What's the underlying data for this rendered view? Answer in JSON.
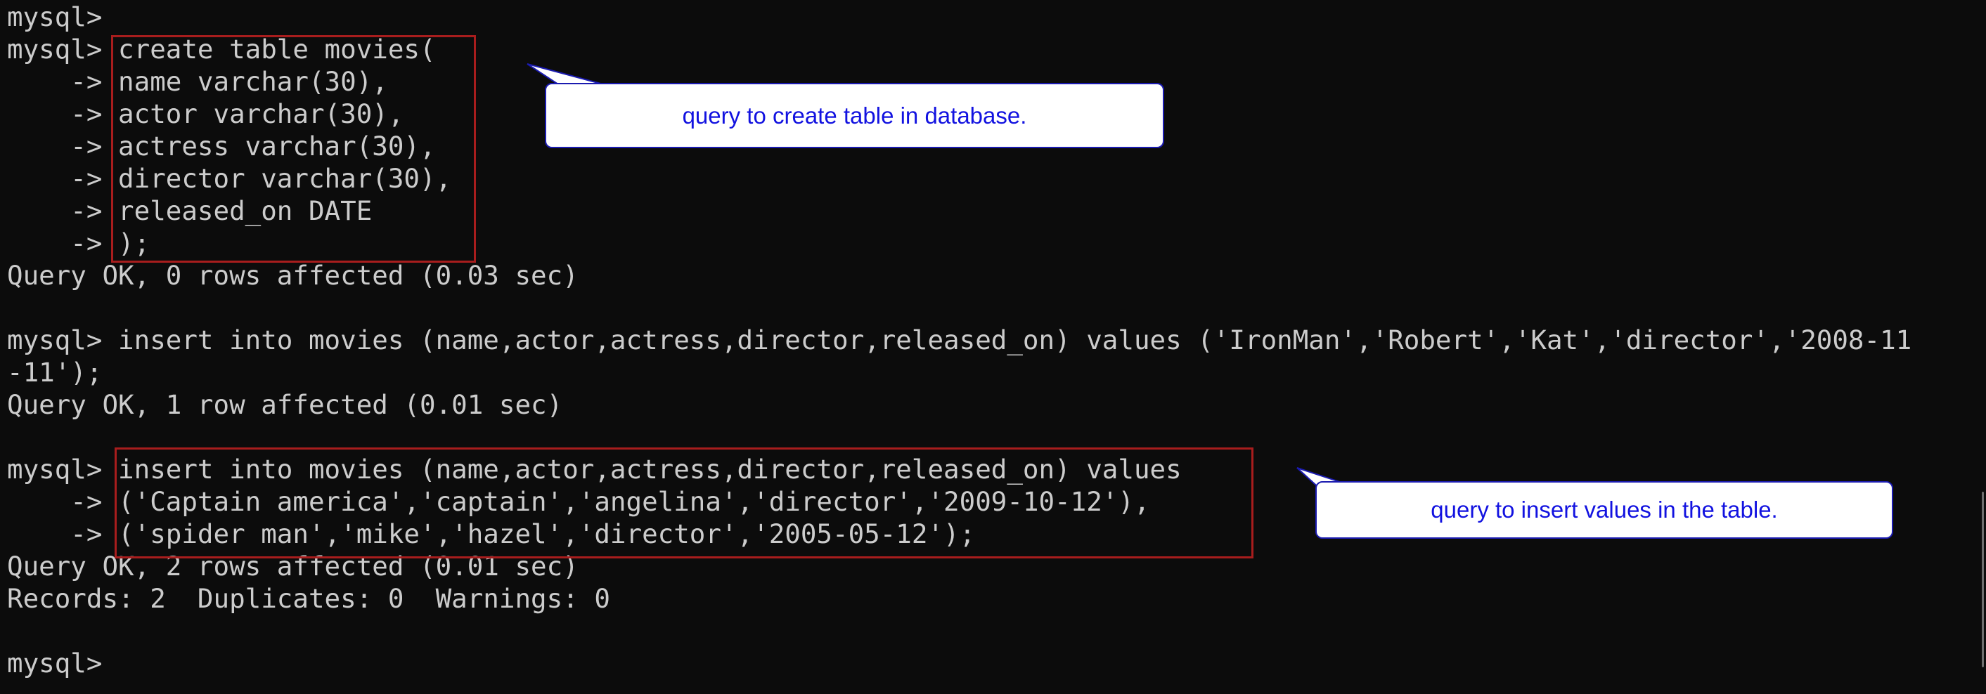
{
  "colors": {
    "background": "#0c0c0c",
    "text": "#cccccc",
    "highlight_border": "#a81d1d",
    "callout_text": "#1212e0",
    "callout_border": "#1b1bb0"
  },
  "terminal": {
    "lines": [
      "mysql>",
      "mysql> create table movies(",
      "    -> name varchar(30),",
      "    -> actor varchar(30),",
      "    -> actress varchar(30),",
      "    -> director varchar(30),",
      "    -> released_on DATE",
      "    -> );",
      "Query OK, 0 rows affected (0.03 sec)",
      "",
      "mysql> insert into movies (name,actor,actress,director,released_on) values ('IronMan','Robert','Kat','director','2008-11",
      "-11');",
      "Query OK, 1 row affected (0.01 sec)",
      "",
      "mysql> insert into movies (name,actor,actress,director,released_on) values",
      "    -> ('Captain america','captain','angelina','director','2009-10-12'),",
      "    -> ('spider man','mike','hazel','director','2005-05-12');",
      "Query OK, 2 rows affected (0.01 sec)",
      "Records: 2  Duplicates: 0  Warnings: 0",
      "",
      "mysql>"
    ]
  },
  "callouts": {
    "create_table": "query to create table in database.",
    "insert_values": "query to insert values in the table."
  }
}
